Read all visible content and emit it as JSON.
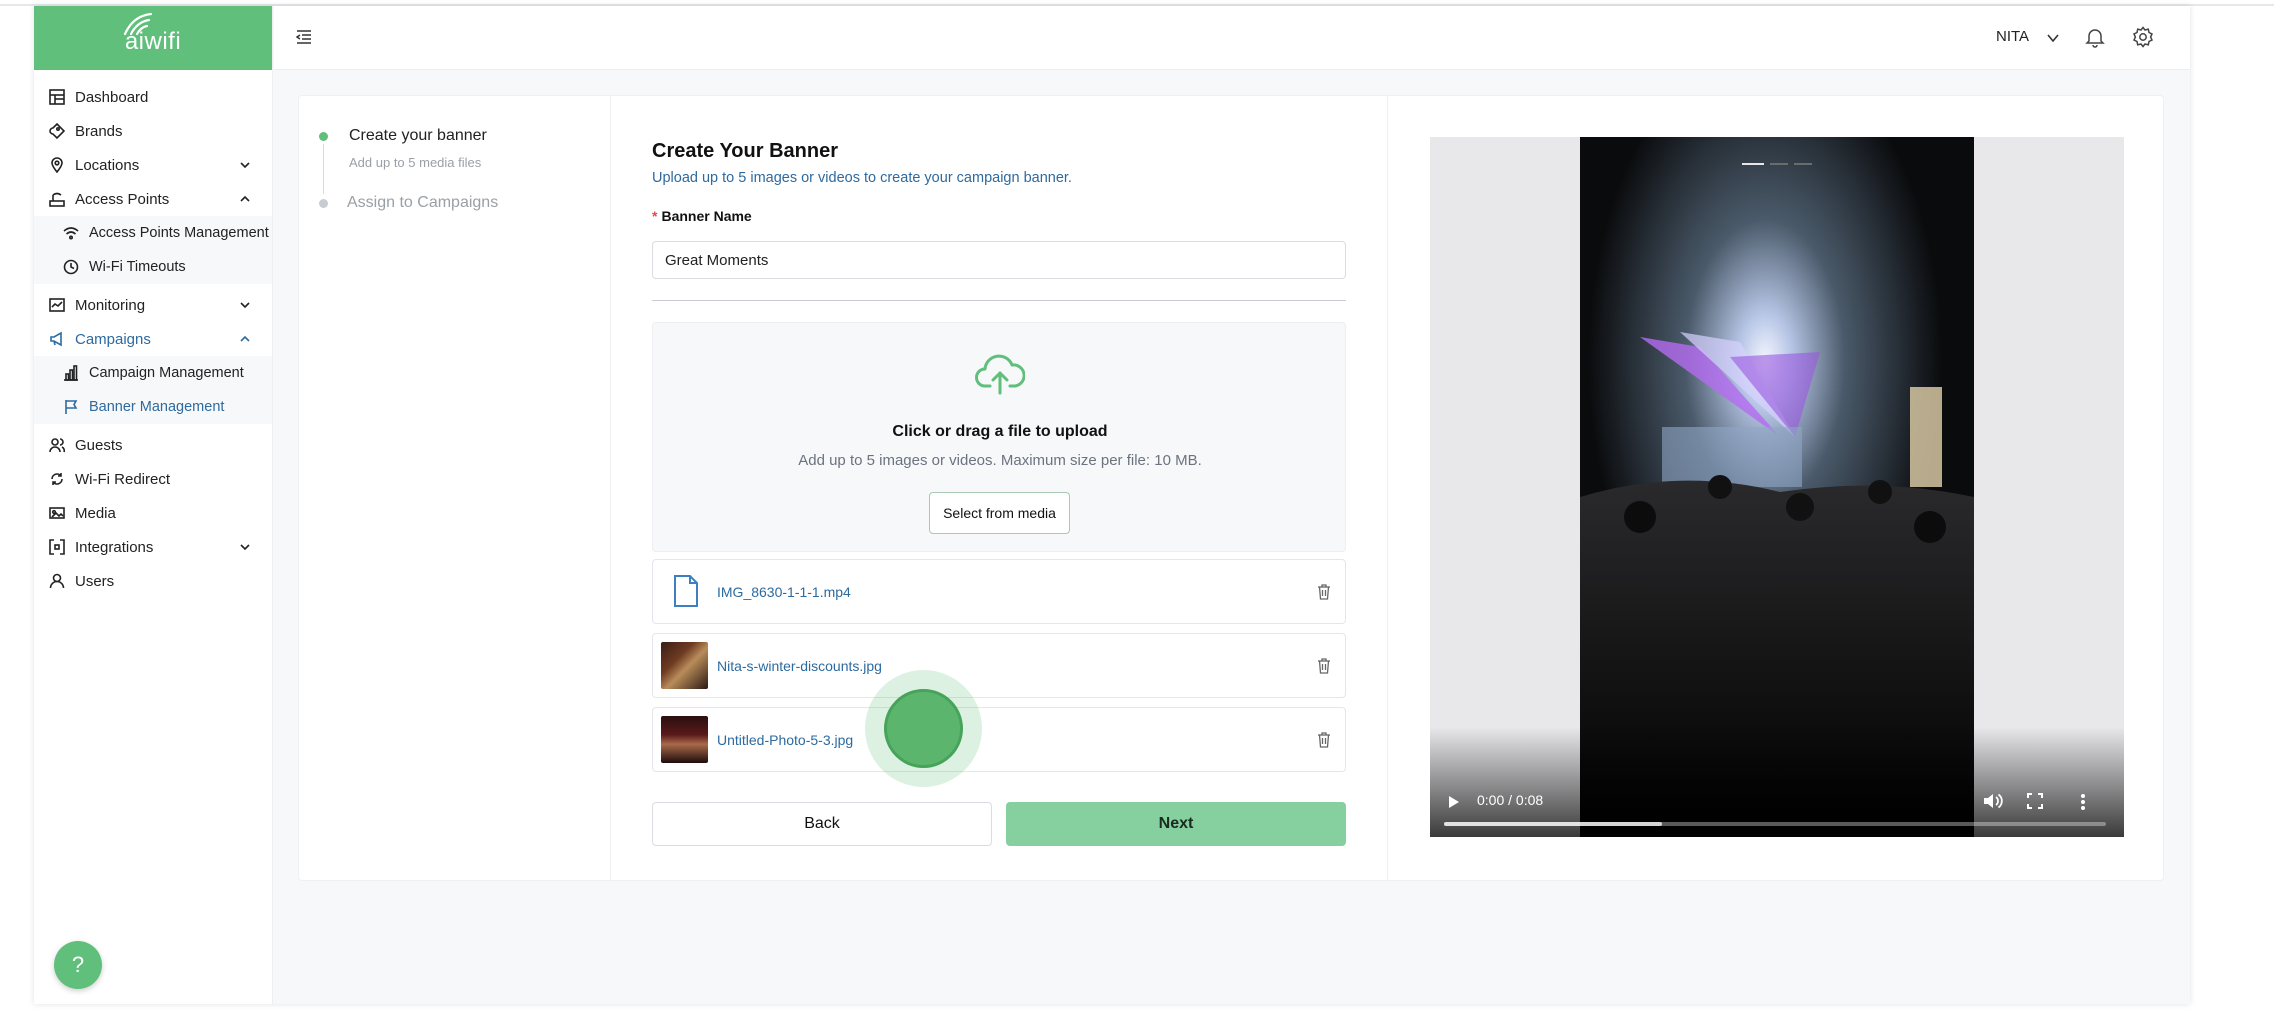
{
  "brand": {
    "name": "aiwifi",
    "color": "#5fbf7b"
  },
  "sidebar": {
    "items": [
      {
        "label": "Dashboard",
        "icon": "dashboard-icon"
      },
      {
        "label": "Brands",
        "icon": "brands-icon"
      },
      {
        "label": "Locations",
        "icon": "location-pin-icon",
        "expanded": false
      },
      {
        "label": "Access Points",
        "icon": "access-point-icon",
        "expanded": true,
        "children": [
          {
            "label": "Access Points Management",
            "icon": "wifi-icon"
          },
          {
            "label": "Wi-Fi Timeouts",
            "icon": "clock-icon"
          }
        ]
      },
      {
        "label": "Monitoring",
        "icon": "monitoring-icon",
        "expanded": false
      },
      {
        "label": "Campaigns",
        "icon": "megaphone-icon",
        "expanded": true,
        "children": [
          {
            "label": "Campaign Management",
            "icon": "bar-chart-icon"
          },
          {
            "label": "Banner Management",
            "icon": "flag-icon",
            "selected": true
          }
        ]
      },
      {
        "label": "Guests",
        "icon": "guests-icon"
      },
      {
        "label": "Wi-Fi Redirect",
        "icon": "redirect-icon"
      },
      {
        "label": "Media",
        "icon": "media-icon"
      },
      {
        "label": "Integrations",
        "icon": "integrations-icon",
        "expanded": false
      },
      {
        "label": "Users",
        "icon": "user-icon"
      }
    ],
    "help_label": "?"
  },
  "header": {
    "user_name": "NITA"
  },
  "steps": [
    {
      "title": "Create your banner",
      "subtitle": "Add up to 5 media files",
      "active": true
    },
    {
      "title": "Assign to Campaigns",
      "active": false
    }
  ],
  "form": {
    "title": "Create Your Banner",
    "subtitle": "Upload up to 5 images or videos to create your campaign banner.",
    "name_label": "Banner Name",
    "name_value": "Great Moments",
    "upload_title": "Click or drag a file to upload",
    "upload_hint": "Add up to 5 images or videos. Maximum size per file: 10 MB.",
    "select_media_label": "Select from media",
    "files": [
      {
        "name": "IMG_8630-1-1-1.mp4",
        "type": "video"
      },
      {
        "name": "Nita-s-winter-discounts.jpg",
        "type": "image"
      },
      {
        "name": "Untitled-Photo-5-3.jpg",
        "type": "image"
      }
    ],
    "back_label": "Back",
    "next_label": "Next"
  },
  "preview": {
    "time": "0:00 / 0:08",
    "slides_total": 3,
    "active_slide": 1,
    "buffered": 0.33
  }
}
